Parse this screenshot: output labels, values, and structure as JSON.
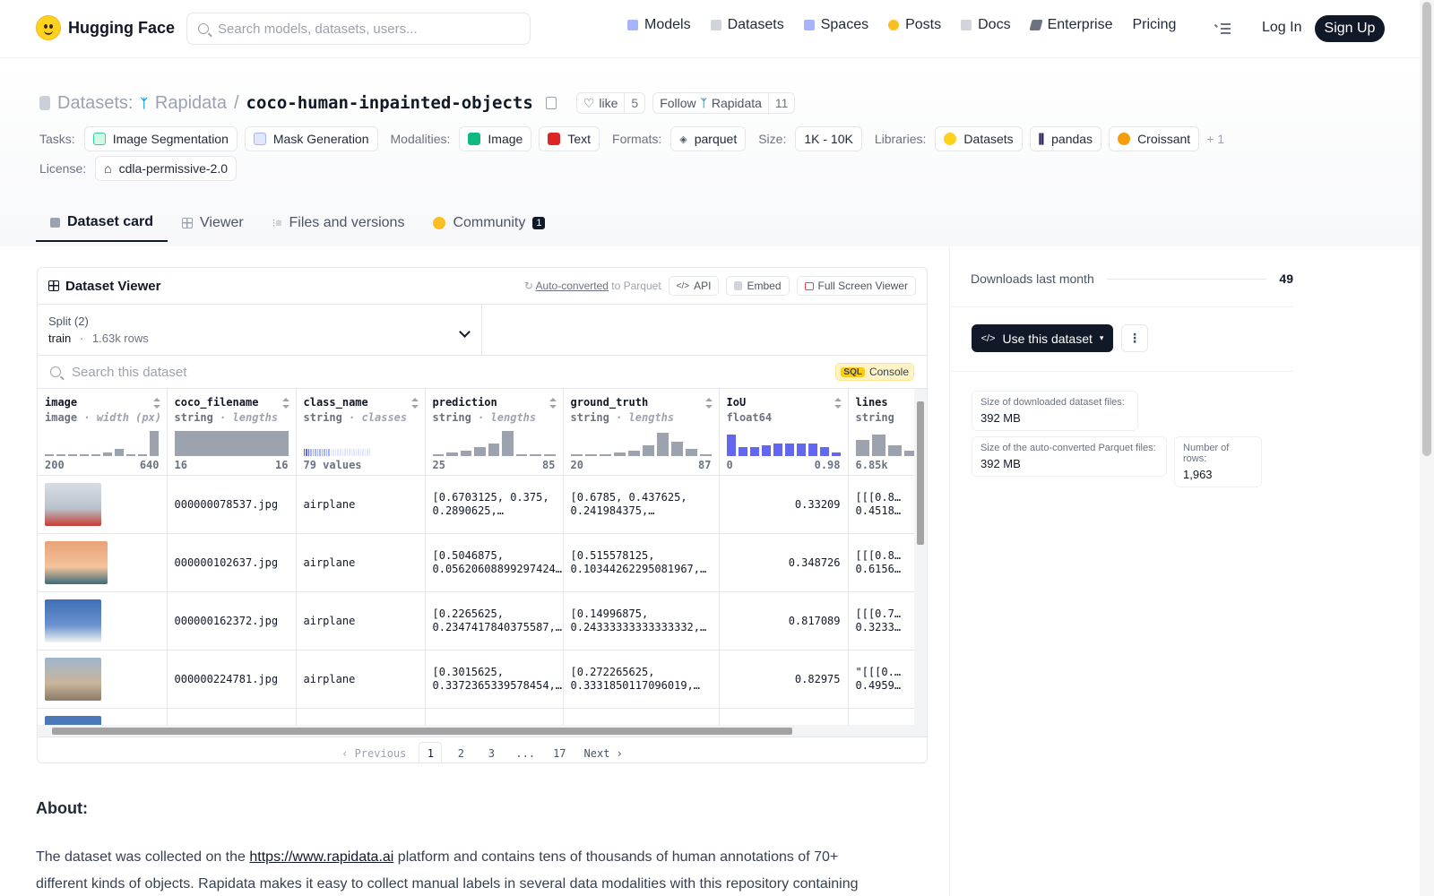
{
  "nav": {
    "brand": "Hugging Face",
    "search_placeholder": "Search models, datasets, users...",
    "links": [
      {
        "label": "Models",
        "icon": "models-icon",
        "color": "#a5b4fc"
      },
      {
        "label": "Datasets",
        "icon": "datasets-icon",
        "color": "#d1d5db"
      },
      {
        "label": "Spaces",
        "icon": "spaces-icon",
        "color": "#a5b4fc"
      },
      {
        "label": "Posts",
        "icon": "posts-icon",
        "color": "#fbbf24"
      },
      {
        "label": "Docs",
        "icon": "docs-icon",
        "color": "#d1d5db"
      },
      {
        "label": "Enterprise",
        "icon": "enterprise-icon",
        "color": "#6b7280"
      },
      {
        "label": "Pricing",
        "icon": "",
        "color": ""
      }
    ],
    "login": "Log In",
    "signup": "Sign Up"
  },
  "header": {
    "section": "Datasets:",
    "owner": "Rapidata",
    "separator": "/",
    "name": "coco-human-inpainted-objects",
    "like_label": "like",
    "like_count": "5",
    "follow_label": "Follow",
    "follow_target": "Rapidata",
    "follow_count": "11",
    "tasks_key": "Tasks:",
    "tasks": [
      "Image Segmentation",
      "Mask Generation"
    ],
    "modalities_key": "Modalities:",
    "modalities": [
      "Image",
      "Text"
    ],
    "formats_key": "Formats:",
    "formats": [
      "parquet"
    ],
    "size_key": "Size:",
    "size": "1K - 10K",
    "libraries_key": "Libraries:",
    "libraries": [
      "Datasets",
      "pandas",
      "Croissant"
    ],
    "libraries_more": "+ 1",
    "license_key": "License:",
    "license": "cdla-permissive-2.0"
  },
  "tabs": [
    {
      "label": "Dataset card",
      "active": true
    },
    {
      "label": "Viewer",
      "active": false
    },
    {
      "label": "Files and versions",
      "active": false
    },
    {
      "label": "Community",
      "active": false,
      "badge": "1"
    }
  ],
  "viewer": {
    "title": "Dataset Viewer",
    "auto_converted_link": "Auto-converted",
    "auto_converted_suffix": "to Parquet",
    "api_label": "API",
    "embed_label": "Embed",
    "fullscreen_label": "Full Screen Viewer",
    "split_label": "Split (2)",
    "split_name": "train",
    "split_dot": "·",
    "split_rows": "1.63k rows",
    "search_placeholder": "Search this dataset",
    "sql_badge": "SQL",
    "sql_label": "Console",
    "columns": [
      {
        "name": "image",
        "type": "image",
        "stat": "width (px)",
        "min": "200",
        "max": "640"
      },
      {
        "name": "coco_filename",
        "type": "string",
        "stat": "lengths",
        "min": "16",
        "max": "16"
      },
      {
        "name": "class_name",
        "type": "string",
        "stat": "classes",
        "min": "79 values",
        "max": ""
      },
      {
        "name": "prediction",
        "type": "string",
        "stat": "lengths",
        "min": "25",
        "max": "85"
      },
      {
        "name": "ground_truth",
        "type": "string",
        "stat": "lengths",
        "min": "20",
        "max": "87"
      },
      {
        "name": "IoU",
        "type": "float64",
        "stat": "",
        "min": "0",
        "max": "0.98"
      },
      {
        "name": "lines",
        "type": "string",
        "stat": "",
        "min": "6.85k",
        "max": ""
      }
    ],
    "rows": [
      {
        "coco_filename": "000000078537.jpg",
        "class_name": "airplane",
        "prediction": "[0.6703125, 0.375, 0.2890625,…",
        "ground_truth": "[0.6785, 0.437625, 0.241984375,…",
        "iou": "0.33209",
        "lines": "[[[0.8… 0.4518…",
        "thumb_colors": [
          "#d7dde4",
          "#b9c2cb",
          "#c73b33"
        ]
      },
      {
        "coco_filename": "000000102637.jpg",
        "class_name": "airplane",
        "prediction": "[0.5046875, 0.05620608899297424…",
        "ground_truth": "[0.515578125, 0.10344262295081967,…",
        "iou": "0.348726",
        "lines": "[[[0.8… 0.6156…",
        "thumb_colors": [
          "#e9a277",
          "#f3c39b",
          "#3b6b7a"
        ]
      },
      {
        "coco_filename": "000000162372.jpg",
        "class_name": "airplane",
        "prediction": "[0.2265625, 0.2347417840375587,…",
        "ground_truth": "[0.14996875, 0.24333333333333332,…",
        "iou": "0.817089",
        "lines": "[[[0.7… 0.3233…",
        "thumb_colors": [
          "#3f6fb6",
          "#6a92cf",
          "#f2f2f2"
        ]
      },
      {
        "coco_filename": "000000224781.jpg",
        "class_name": "airplane",
        "prediction": "[0.3015625, 0.3372365339578454,…",
        "ground_truth": "[0.272265625, 0.3331850117096019,…",
        "iou": "0.82975",
        "lines": "\"[[[0.… 0.4959…",
        "thumb_colors": [
          "#9fb6cf",
          "#c9b59a",
          "#8a7a66"
        ]
      }
    ],
    "pager": {
      "previous": "Previous",
      "pages": [
        "1",
        "2",
        "3",
        "...",
        "17"
      ],
      "next": "Next",
      "current": "1"
    }
  },
  "about": {
    "heading": "About:",
    "text_before": "The dataset was collected on the ",
    "link": "https://www.rapidata.ai",
    "text_after": " platform and contains tens of thousands of human annotations of 70+ different kinds of objects. Rapidata makes it easy to collect manual labels in several data modalities with this repository containing"
  },
  "sidebar": {
    "downloads_label": "Downloads last month",
    "downloads_value": "49",
    "use_button": "Use this dataset",
    "stats": [
      {
        "label": "Size of downloaded dataset files:",
        "value": "392 MB"
      },
      {
        "label": "Size of the auto-converted Parquet files:",
        "value": "392 MB"
      },
      {
        "label": "Number of rows:",
        "value": "1,963"
      }
    ]
  }
}
